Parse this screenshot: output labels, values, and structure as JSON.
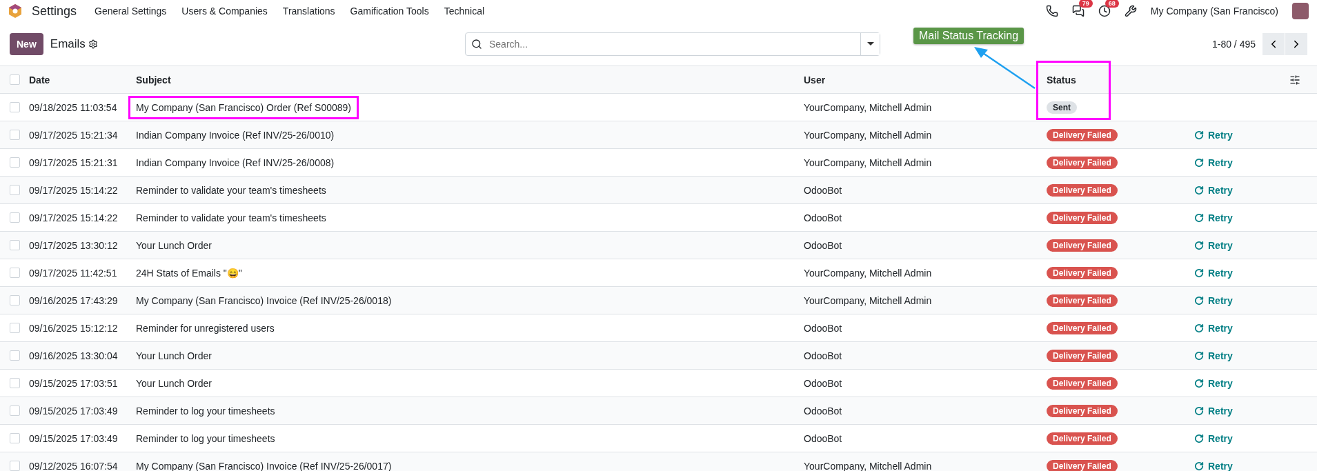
{
  "navbar": {
    "app": "Settings",
    "menus": [
      "General Settings",
      "Users & Companies",
      "Translations",
      "Gamification Tools",
      "Technical"
    ],
    "messages_count": "79",
    "activities_count": "68",
    "company": "My Company (San Francisco)"
  },
  "control_panel": {
    "new_button": "New",
    "title": "Emails",
    "search": {
      "placeholder": "Search..."
    },
    "pager": "1-80 / 495"
  },
  "annotation": {
    "label": "Mail Status Tracking"
  },
  "table": {
    "all_checked": false,
    "columns": [
      {
        "label": "Date",
        "highlighted": false
      },
      {
        "label": "Subject",
        "highlighted": false
      },
      {
        "label": "User",
        "highlighted": false
      },
      {
        "label": "Status",
        "highlighted": true
      }
    ],
    "rows": [
      {
        "checked": false,
        "date": "09/18/2025 11:03:54",
        "subject": "My Company (San Francisco) Order (Ref S00089)",
        "user": "YourCompany, Mitchell Admin",
        "status": {
          "kind": "sent",
          "label": "Sent"
        },
        "highlighted": true
      },
      {
        "checked": false,
        "date": "09/17/2025 15:21:34",
        "subject": "Indian Company Invoice (Ref INV/25-26/0010)",
        "user": "YourCompany, Mitchell Admin",
        "status": {
          "kind": "failed",
          "label": "Delivery Failed"
        },
        "action": "Retry",
        "highlighted": false
      },
      {
        "checked": false,
        "date": "09/17/2025 15:21:31",
        "subject": "Indian Company Invoice (Ref INV/25-26/0008)",
        "user": "YourCompany, Mitchell Admin",
        "status": {
          "kind": "failed",
          "label": "Delivery Failed"
        },
        "action": "Retry",
        "highlighted": false
      },
      {
        "checked": false,
        "date": "09/17/2025 15:14:22",
        "subject": "Reminder to validate your team's timesheets",
        "user": "OdooBot",
        "status": {
          "kind": "failed",
          "label": "Delivery Failed"
        },
        "action": "Retry",
        "highlighted": false
      },
      {
        "checked": false,
        "date": "09/17/2025 15:14:22",
        "subject": "Reminder to validate your team's timesheets",
        "user": "OdooBot",
        "status": {
          "kind": "failed",
          "label": "Delivery Failed"
        },
        "action": "Retry",
        "highlighted": false
      },
      {
        "checked": false,
        "date": "09/17/2025 13:30:12",
        "subject": "Your Lunch Order",
        "user": "OdooBot",
        "status": {
          "kind": "failed",
          "label": "Delivery Failed"
        },
        "action": "Retry",
        "highlighted": false
      },
      {
        "checked": false,
        "date": "09/17/2025 11:42:51",
        "subject": "24H Stats of Emails \"😄\"",
        "user": "YourCompany, Mitchell Admin",
        "status": {
          "kind": "failed",
          "label": "Delivery Failed"
        },
        "action": "Retry",
        "highlighted": false
      },
      {
        "checked": false,
        "date": "09/16/2025 17:43:29",
        "subject": "My Company (San Francisco) Invoice (Ref INV/25-26/0018)",
        "user": "YourCompany, Mitchell Admin",
        "status": {
          "kind": "failed",
          "label": "Delivery Failed"
        },
        "action": "Retry",
        "highlighted": false
      },
      {
        "checked": false,
        "date": "09/16/2025 15:12:12",
        "subject": "Reminder for unregistered users",
        "user": "OdooBot",
        "status": {
          "kind": "failed",
          "label": "Delivery Failed"
        },
        "action": "Retry",
        "highlighted": false
      },
      {
        "checked": false,
        "date": "09/16/2025 13:30:04",
        "subject": "Your Lunch Order",
        "user": "OdooBot",
        "status": {
          "kind": "failed",
          "label": "Delivery Failed"
        },
        "action": "Retry",
        "highlighted": false
      },
      {
        "checked": false,
        "date": "09/15/2025 17:03:51",
        "subject": "Your Lunch Order",
        "user": "OdooBot",
        "status": {
          "kind": "failed",
          "label": "Delivery Failed"
        },
        "action": "Retry",
        "highlighted": false
      },
      {
        "checked": false,
        "date": "09/15/2025 17:03:49",
        "subject": "Reminder to log your timesheets",
        "user": "OdooBot",
        "status": {
          "kind": "failed",
          "label": "Delivery Failed"
        },
        "action": "Retry",
        "highlighted": false
      },
      {
        "checked": false,
        "date": "09/15/2025 17:03:49",
        "subject": "Reminder to log your timesheets",
        "user": "OdooBot",
        "status": {
          "kind": "failed",
          "label": "Delivery Failed"
        },
        "action": "Retry",
        "highlighted": false
      },
      {
        "checked": false,
        "date": "09/12/2025 16:07:54",
        "subject": "My Company (San Francisco) Invoice (Ref INV/25-26/0017)",
        "user": "YourCompany, Mitchell Admin",
        "status": {
          "kind": "failed",
          "label": "Delivery Failed"
        },
        "action": "Retry",
        "highlighted": false
      }
    ]
  }
}
